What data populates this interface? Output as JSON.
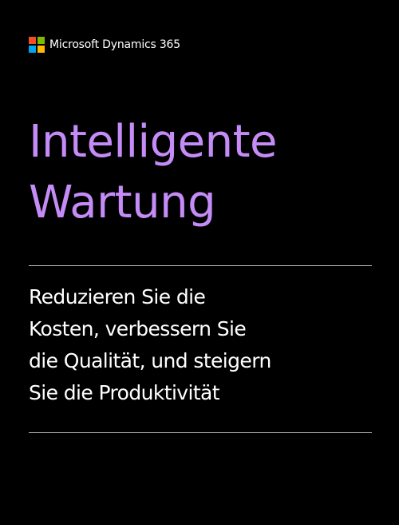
{
  "brand": {
    "name": "Microsoft Dynamics 365",
    "logo_colors": [
      "#f25022",
      "#7fba00",
      "#00a4ef",
      "#ffb900"
    ]
  },
  "title": {
    "lines": [
      "Intelligente",
      "Wartung"
    ],
    "color": "#c58cf7"
  },
  "subtitle": {
    "lines": [
      "Reduzieren Sie die",
      "Kosten, verbessern Sie",
      "die Qualität, und steigern",
      "Sie die Produktivität"
    ],
    "color": "#ffffff"
  },
  "colors": {
    "background": "#000000",
    "rule": "#bdbdbd"
  }
}
